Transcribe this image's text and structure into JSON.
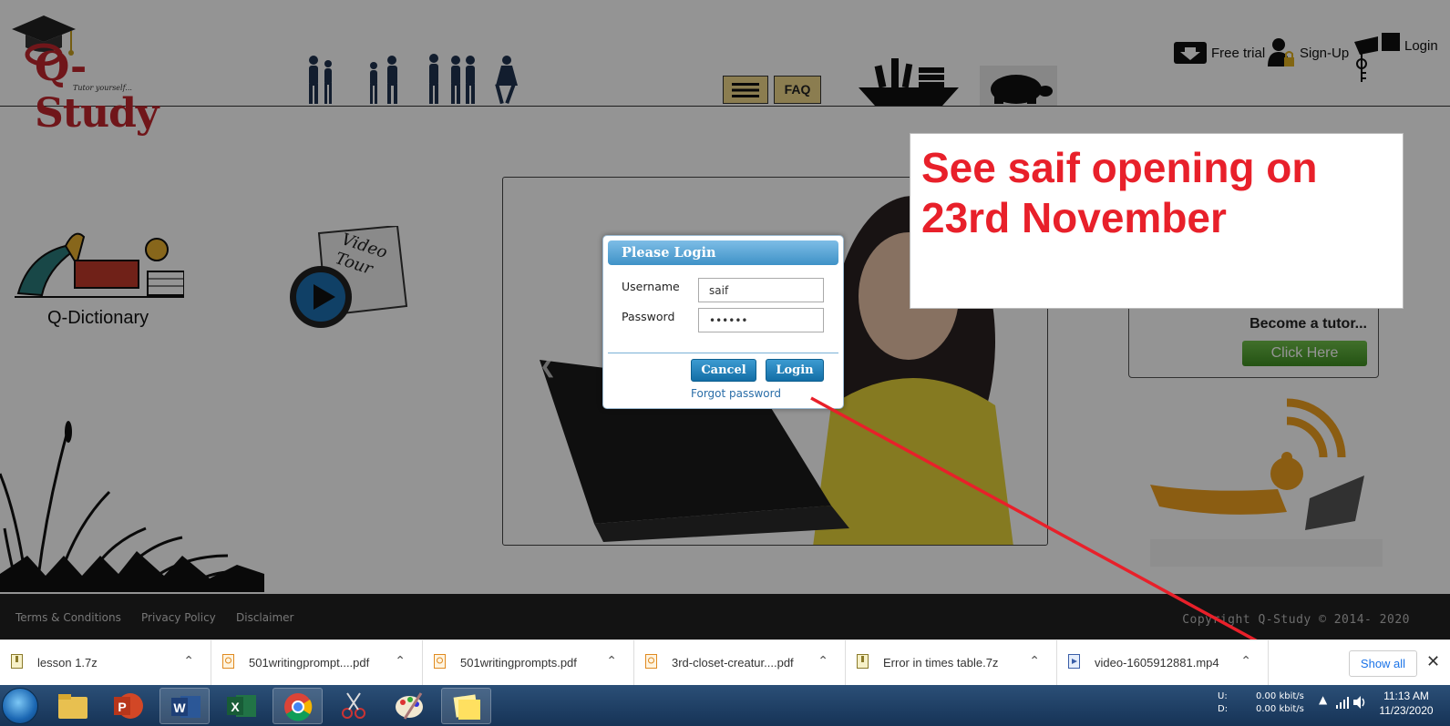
{
  "header": {
    "logo_text": "Q-Study",
    "logo_tagline": "Tutor yourself...",
    "faq_label": "FAQ",
    "free_trial_label": "Free trial",
    "signup_label": "Sign-Up",
    "login_label": "Login"
  },
  "main": {
    "qdictionary_label": "Q-Dictionary",
    "video_tour_label": "Video Tour",
    "tutor_title": "Become a tutor...",
    "tutor_button": "Click Here"
  },
  "modal": {
    "title": "Please Login",
    "username_label": "Username",
    "username_value": "saif",
    "password_label": "Password",
    "password_value": "••••••",
    "cancel_label": "Cancel",
    "login_label": "Login",
    "forgot_label": "Forgot password"
  },
  "annotation": {
    "text": "See saif opening on 23rd November",
    "color": "#e8202a"
  },
  "footer": {
    "links": [
      "Terms & Conditions",
      "Privacy Policy",
      "Disclaimer"
    ],
    "copyright": "Copyright Q-Study © 2014- 2020"
  },
  "downloads": {
    "items": [
      {
        "name": "lesson 1.7z",
        "icon": "archive-icon"
      },
      {
        "name": "501writingprompt....pdf",
        "icon": "pdf-icon"
      },
      {
        "name": "501writingprompts.pdf",
        "icon": "pdf-icon"
      },
      {
        "name": "3rd-closet-creatur....pdf",
        "icon": "pdf-icon"
      },
      {
        "name": "Error in times table.7z",
        "icon": "archive-icon"
      },
      {
        "name": "video-1605912881.mp4",
        "icon": "video-file-icon"
      }
    ],
    "show_all": "Show all"
  },
  "taskbar": {
    "net_up_label": "U:",
    "net_down_label": "D:",
    "net_up_value": "0.00 kbit/s",
    "net_down_value": "0.00 kbit/s",
    "time": "11:13 AM",
    "date": "11/23/2020"
  }
}
